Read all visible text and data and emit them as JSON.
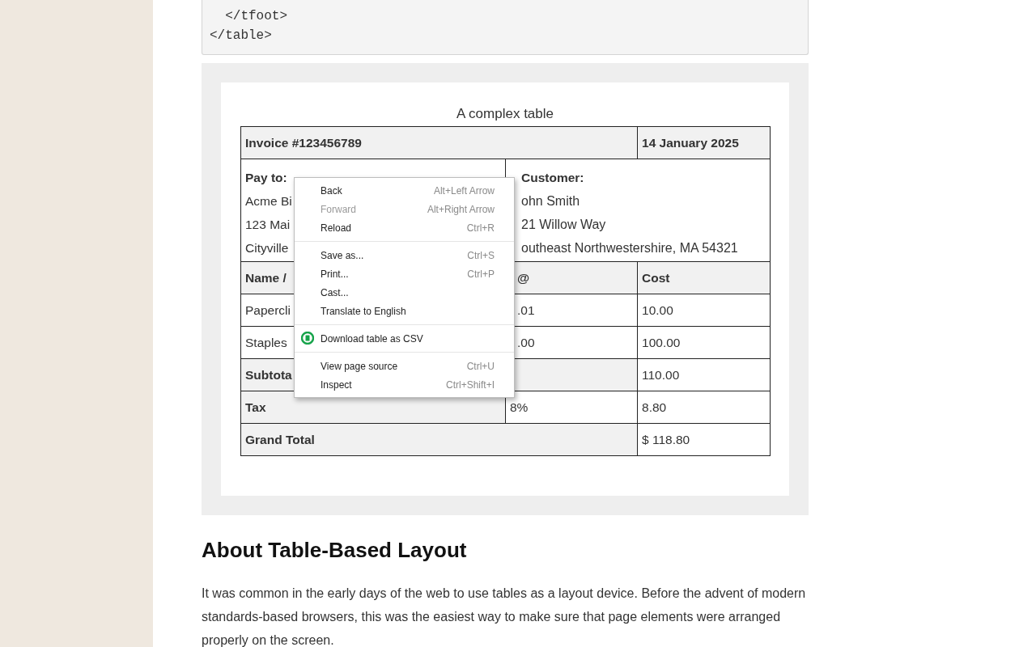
{
  "code_block": {
    "lines": [
      "  </tfoot>",
      "</table>"
    ]
  },
  "table": {
    "caption": "A complex table",
    "invoice": "Invoice #123456789",
    "date": "14 January 2025",
    "pay_to": {
      "heading": "Pay to:",
      "lines": [
        "Acme Bi",
        "123 Mai",
        "Cityville"
      ]
    },
    "customer": {
      "heading": "Customer:",
      "lines": [
        "ohn Smith",
        "21 Willow Way",
        "outheast Northwestershire, MA 54321"
      ]
    },
    "header": [
      "Name /",
      "@",
      "Cost"
    ],
    "items": [
      [
        "Papercli",
        ".01",
        "10.00"
      ],
      [
        "Staples",
        ".00",
        "100.00"
      ]
    ],
    "subtotal": {
      "label": "Subtota",
      "value": "110.00"
    },
    "tax": {
      "label": "Tax",
      "rate": "8%",
      "value": "8.80"
    },
    "grand_total": {
      "label": "Grand Total",
      "value": "$ 118.80"
    }
  },
  "context_menu": {
    "groups": [
      [
        {
          "kind": "item",
          "label": "Back",
          "shortcut": "Alt+Left Arrow",
          "disabled": false
        },
        {
          "kind": "item",
          "label": "Forward",
          "shortcut": "Alt+Right Arrow",
          "disabled": true
        },
        {
          "kind": "item",
          "label": "Reload",
          "shortcut": "Ctrl+R",
          "disabled": false
        }
      ],
      [
        {
          "kind": "item",
          "label": "Save as...",
          "shortcut": "Ctrl+S",
          "disabled": false
        },
        {
          "kind": "item",
          "label": "Print...",
          "shortcut": "Ctrl+P",
          "disabled": false
        },
        {
          "kind": "item",
          "label": "Cast...",
          "disabled": false
        },
        {
          "kind": "item",
          "label": "Translate to English",
          "disabled": false
        }
      ],
      [
        {
          "kind": "extension",
          "label": "Download table as CSV",
          "disabled": false
        }
      ],
      [
        {
          "kind": "item",
          "label": "View page source",
          "shortcut": "Ctrl+U",
          "disabled": false
        },
        {
          "kind": "item",
          "label": "Inspect",
          "shortcut": "Ctrl+Shift+I",
          "disabled": false
        }
      ]
    ]
  },
  "heading": "About Table-Based Layout",
  "paragraph": "It was common in the early days of the web to use tables as a layout device. Before the advent of modern standards-based browsers, this was the easiest way to make sure that page elements were arranged properly on the screen."
}
